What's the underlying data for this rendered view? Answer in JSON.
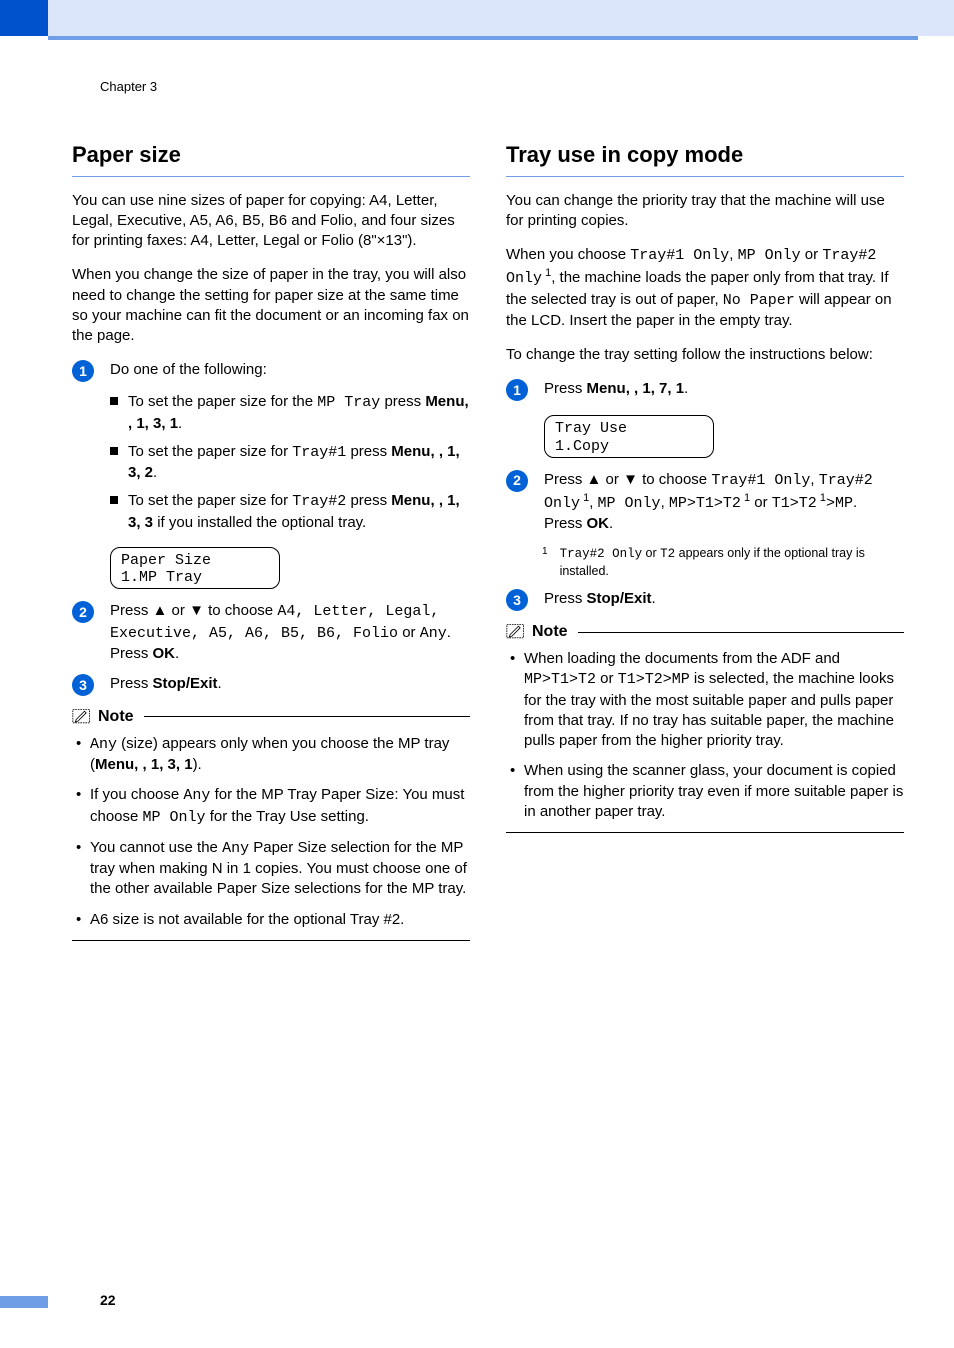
{
  "chapter": "Chapter 3",
  "page_number": "22",
  "left": {
    "heading": "Paper size",
    "p1": "You can use nine sizes of paper for copying: A4, Letter, Legal, Executive, A5, A6, B5, B6 and Folio, and four sizes for printing faxes: A4, Letter, Legal or Folio (8\"×13\").",
    "p2": "When you change the size of paper in the tray, you will also need to change the setting for paper size at the same time so your machine can fit the document or an incoming fax on the page.",
    "step1": "Do one of the following:",
    "s1a_pre": "To set the paper size for the ",
    "s1a_mono": "MP Tray",
    "s1a_mid": " press ",
    "s1a_menu": "Menu",
    "s1a_tail": ", 1, 3, 1",
    "s1b_pre": "To set the paper size for ",
    "s1b_mono": "Tray#1",
    "s1b_mid": " press ",
    "s1b_menu": "Menu",
    "s1b_tail": ", 1, 3, 2",
    "s1c_pre": "To set the paper size for ",
    "s1c_mono": "Tray#2",
    "s1c_mid": " press ",
    "s1c_menu": "Menu",
    "s1c_tail1": ", 1, 3, 3",
    "s1c_tail2": " if you installed the optional tray.",
    "lcd1_l1": "Paper Size",
    "lcd1_l2": "1.MP Tray",
    "step2_pre": "Press ",
    "step2_mid1": " or ",
    "step2_mid2": " to choose ",
    "step2_opts": "A4, Letter, Legal, Executive, A5, A6, B5, B6, Folio",
    "step2_or": " or ",
    "step2_any": "Any",
    "step2_end": ".",
    "step2_press": "Press ",
    "step2_ok": "OK",
    "step3_pre": "Press ",
    "step3_btn": "Stop/Exit",
    "note_label": "Note",
    "note1_pre": "",
    "note1_any": "Any",
    "note1_mid": " (size) appears only when you choose the MP tray (",
    "note1_menu": "Menu",
    "note1_tail": ", 1, 3, 1",
    "note1_end": ").",
    "note2_pre": "If you choose ",
    "note2_any": "Any",
    "note2_mid": " for the MP Tray Paper Size: You must choose ",
    "note2_mp": "MP Only",
    "note2_end": " for the Tray Use setting.",
    "note3_pre": "You cannot use the ",
    "note3_any": "Any",
    "note3_end": " Paper Size selection for the MP tray when making N in 1 copies. You must choose one of the other available Paper Size selections for the MP tray.",
    "note4": "A6 size is not available for the optional Tray #2."
  },
  "right": {
    "heading": "Tray use in copy mode",
    "p1": "You can change the priority tray that the machine will use for printing copies.",
    "p2_pre": "When you choose ",
    "p2_a": "Tray#1 Only",
    "p2_b": "MP Only",
    "p2_c": "Tray#2 Only",
    "p2_mid": ", the machine loads the paper only from that tray. If the selected tray is out of paper, ",
    "p2_np": "No Paper",
    "p2_end": " will appear on the LCD. Insert the paper in the empty tray.",
    "p3": "To change the tray setting follow the instructions below:",
    "step1_pre": "Press ",
    "step1_menu": "Menu",
    "step1_tail": ", 1, 7, 1",
    "lcd_l1": "Tray Use",
    "lcd_l2": "1.Copy",
    "step2_pre": "Press ",
    "step2_mid1": " or ",
    "step2_mid2": " to choose ",
    "step2_a": "Tray#1 Only",
    "step2_b": "Tray#2 Only",
    "step2_c": "MP Only",
    "step2_d": "MP>T1>T2",
    "step2_or": " or ",
    "step2_e": "T1>T2",
    "step2_f": ">MP",
    "step2_press": "Press ",
    "step2_ok": "OK",
    "fn_pre": "",
    "fn_a": "Tray#2 Only",
    "fn_mid": " or ",
    "fn_b": "T2",
    "fn_end": " appears only if the optional tray is installed.",
    "step3_pre": "Press ",
    "step3_btn": "Stop/Exit",
    "note_label": "Note",
    "note1_pre": "When loading the documents from the ADF and ",
    "note1_a": "MP>T1>T2",
    "note1_mid": " or ",
    "note1_b": "T1>T2>MP",
    "note1_end": " is selected, the machine looks for the tray with the most suitable paper and pulls paper from that tray. If no tray has suitable paper, the machine pulls paper from the higher priority tray.",
    "note2": "When using the scanner glass, your document is copied from the higher priority tray even if more suitable paper is in another paper tray."
  }
}
